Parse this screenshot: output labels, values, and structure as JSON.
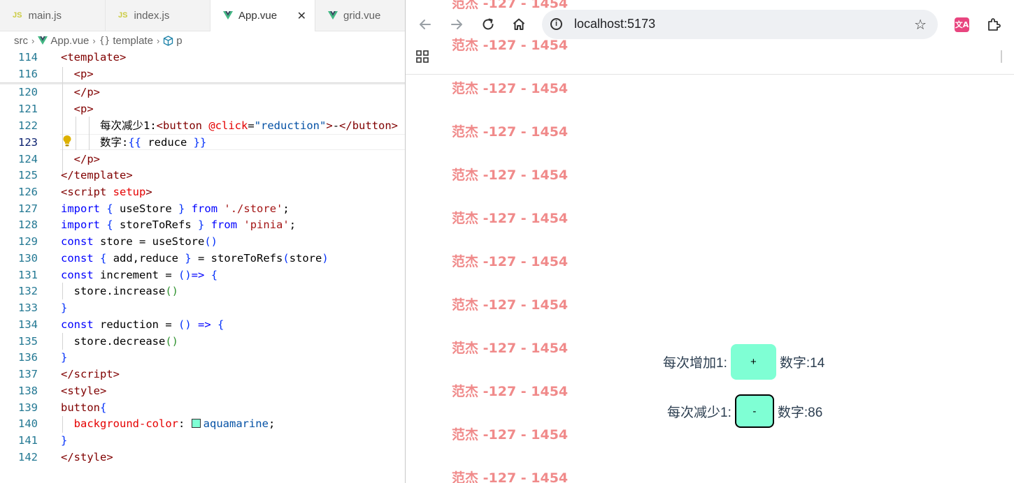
{
  "editor": {
    "tabs": [
      {
        "label": "main.js",
        "icon": "js-icon"
      },
      {
        "label": "index.js",
        "icon": "js-icon"
      },
      {
        "label": "App.vue",
        "icon": "vue-icon",
        "active": true
      },
      {
        "label": "grid.vue",
        "icon": "vue-icon"
      }
    ],
    "breadcrumb": {
      "src": "src",
      "file": "App.vue",
      "template": "template",
      "element": "p"
    },
    "line_numbers": [
      "114",
      "116",
      "120",
      "121",
      "122",
      "123",
      "124",
      "125",
      "126",
      "127",
      "128",
      "129",
      "130",
      "131",
      "132",
      "133",
      "134",
      "135",
      "136",
      "137",
      "138",
      "139",
      "140",
      "141",
      "142"
    ],
    "current_line": "123",
    "swatch_color": "#7fffd4"
  },
  "browser": {
    "url": "localhost:5173",
    "repeated_text": "范杰 -127 - 1454",
    "increase_label": "每次增加1:",
    "increase_button": "+",
    "increase_value": "数字:14",
    "decrease_label": "每次减少1:",
    "decrease_button": "-",
    "decrease_value": "数字:86",
    "button_color": "#7fffd4",
    "text_color": "#f08a8a"
  }
}
